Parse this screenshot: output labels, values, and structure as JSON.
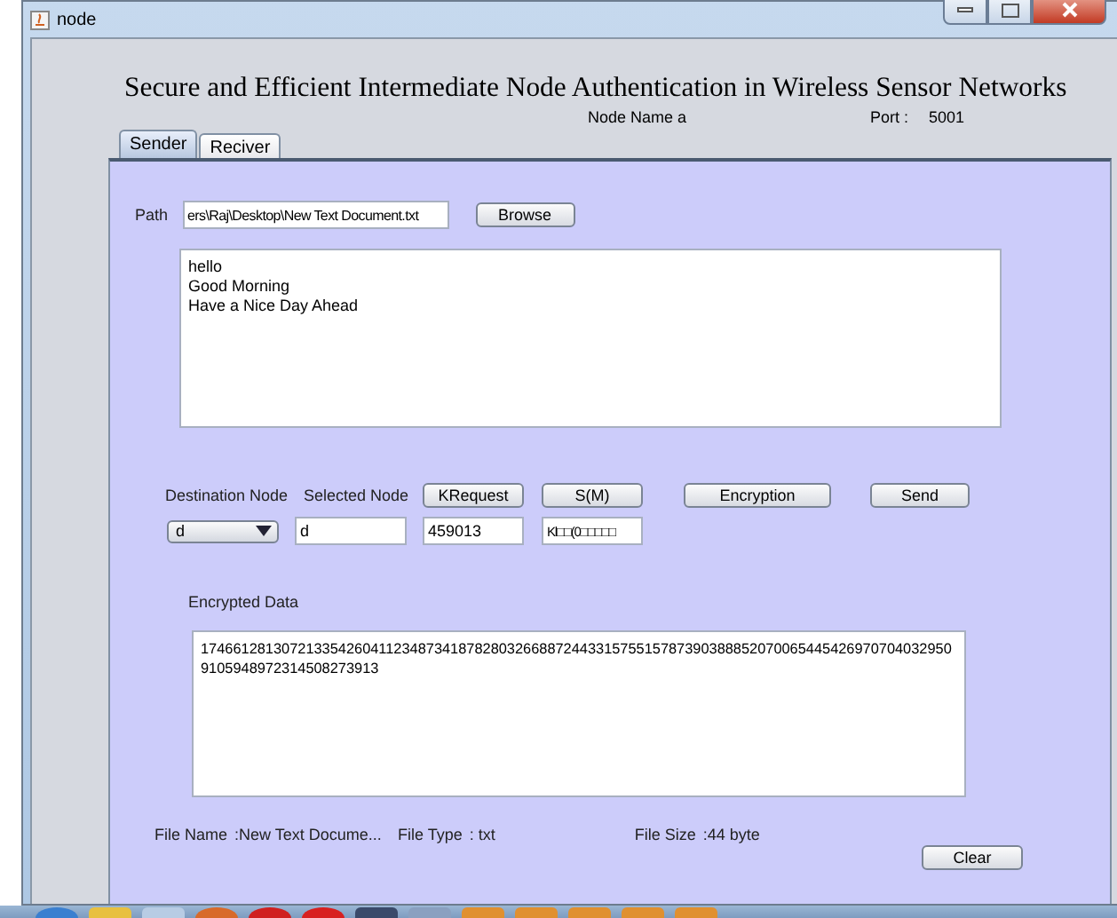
{
  "window": {
    "title": "node"
  },
  "heading": "Secure and Efficient Intermediate Node Authentication in Wireless Sensor Networks",
  "node_name": "Node Name a",
  "port": {
    "label": "Port  :",
    "value": "5001"
  },
  "tabs": [
    {
      "label": "Sender",
      "selected": true
    },
    {
      "label": "Reciver",
      "selected": false
    }
  ],
  "path": {
    "label": "Path",
    "value": "ers\\Raj\\Desktop\\New Text Document.txt",
    "button": "Browse"
  },
  "message_lines": [
    "hello",
    "Good Morning",
    "Have a Nice Day Ahead"
  ],
  "labels": {
    "destination": "Destination Node",
    "selected": "Selected Node",
    "encrypted": "Encrypted Data"
  },
  "buttons": [
    {
      "label": "KRequest"
    },
    {
      "label": "S(M)"
    },
    {
      "label": "Encryption"
    },
    {
      "label": "Send"
    }
  ],
  "destination_value": "d",
  "fields": [
    "d",
    "459013",
    "Kl□□(0□□□□□"
  ],
  "encrypted_lines": [
    "17466128130721335426041123487341878280326688724433157551578739038885207006544542697070403295​0",
    "910594897231450827391​3"
  ],
  "file_info": [
    {
      "label": "File Name",
      "value": ":New Text Docume..."
    },
    {
      "label": "File Type",
      "value": ": txt"
    },
    {
      "label": "File Size",
      "value": ":44 byte"
    }
  ],
  "clear_button": "Clear"
}
